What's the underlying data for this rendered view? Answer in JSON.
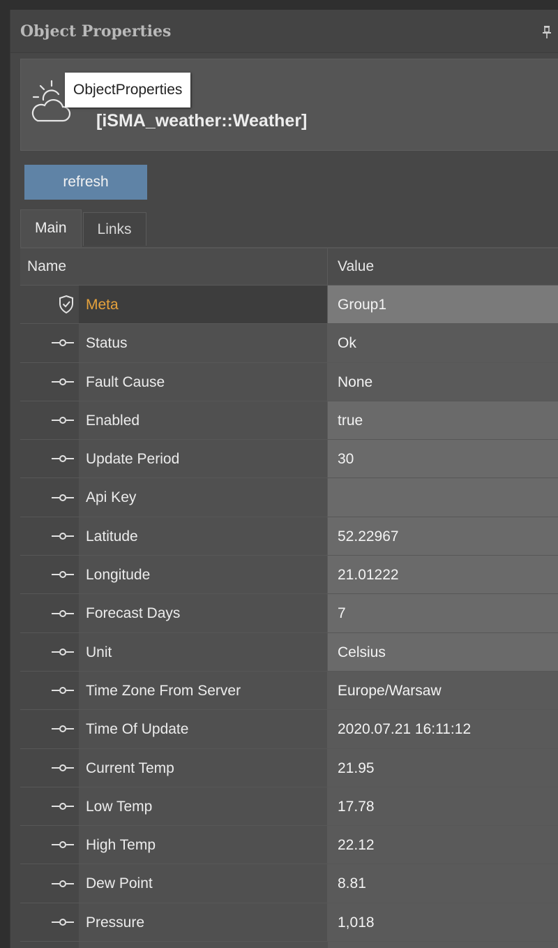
{
  "panel": {
    "title": "Object Properties",
    "tooltip": "ObjectProperties",
    "object_path": "[iSMA_weather::Weather]"
  },
  "toolbar": {
    "refresh_label": "refresh"
  },
  "tabs": [
    {
      "label": "Main",
      "active": true
    },
    {
      "label": "Links",
      "active": false
    }
  ],
  "grid": {
    "headers": {
      "name": "Name",
      "value": "Value"
    },
    "rows": [
      {
        "name": "Meta",
        "value": "Group1",
        "icon": "shield-check-icon"
      },
      {
        "name": "Status",
        "value": "Ok",
        "icon": "slot-icon"
      },
      {
        "name": "Fault Cause",
        "value": "None",
        "icon": "slot-icon"
      },
      {
        "name": "Enabled",
        "value": "true",
        "icon": "slot-icon"
      },
      {
        "name": "Update Period",
        "value": "30",
        "icon": "slot-icon"
      },
      {
        "name": "Api Key",
        "value": "",
        "icon": "slot-icon"
      },
      {
        "name": "Latitude",
        "value": "52.22967",
        "icon": "slot-icon"
      },
      {
        "name": "Longitude",
        "value": "21.01222",
        "icon": "slot-icon"
      },
      {
        "name": "Forecast Days",
        "value": "7",
        "icon": "slot-icon"
      },
      {
        "name": "Unit",
        "value": "Celsius",
        "icon": "slot-icon"
      },
      {
        "name": "Time Zone From Server",
        "value": "Europe/Warsaw",
        "icon": "slot-icon"
      },
      {
        "name": "Time Of Update",
        "value": "2020.07.21 16:11:12",
        "icon": "slot-icon"
      },
      {
        "name": "Current Temp",
        "value": "21.95",
        "icon": "slot-icon"
      },
      {
        "name": "Low Temp",
        "value": "17.78",
        "icon": "slot-icon"
      },
      {
        "name": "High Temp",
        "value": "22.12",
        "icon": "slot-icon"
      },
      {
        "name": "Dew Point",
        "value": "8.81",
        "icon": "slot-icon"
      },
      {
        "name": "Pressure",
        "value": "1,018",
        "icon": "slot-icon"
      }
    ]
  },
  "colors": {
    "meta_name": "#e6a23c",
    "refresh_button": "#5f83a6"
  }
}
